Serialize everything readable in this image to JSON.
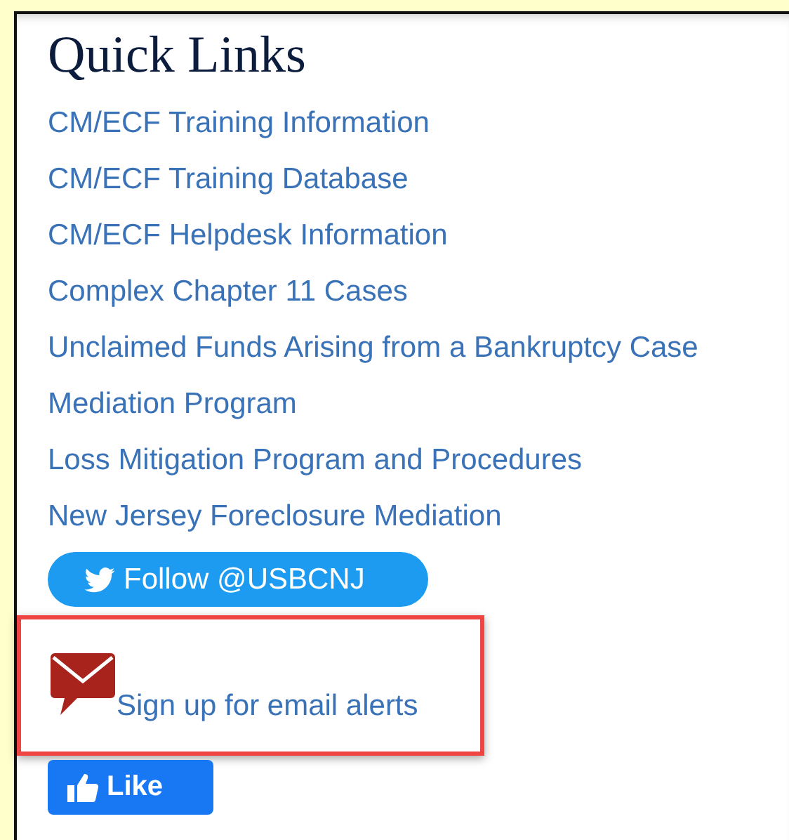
{
  "panel": {
    "title": "Quick Links",
    "links": [
      "CM/ECF Training Information",
      "CM/ECF Training Database",
      "CM/ECF Helpdesk Information",
      "Complex Chapter 11 Cases",
      "Unclaimed Funds Arising from a Bankruptcy Case",
      "Mediation Program",
      "Loss Mitigation Program and Procedures",
      "New Jersey Foreclosure Mediation"
    ],
    "follow_button": "Follow @USBCNJ",
    "email_alert_link": "Sign up for email alerts",
    "like_button": "Like"
  }
}
